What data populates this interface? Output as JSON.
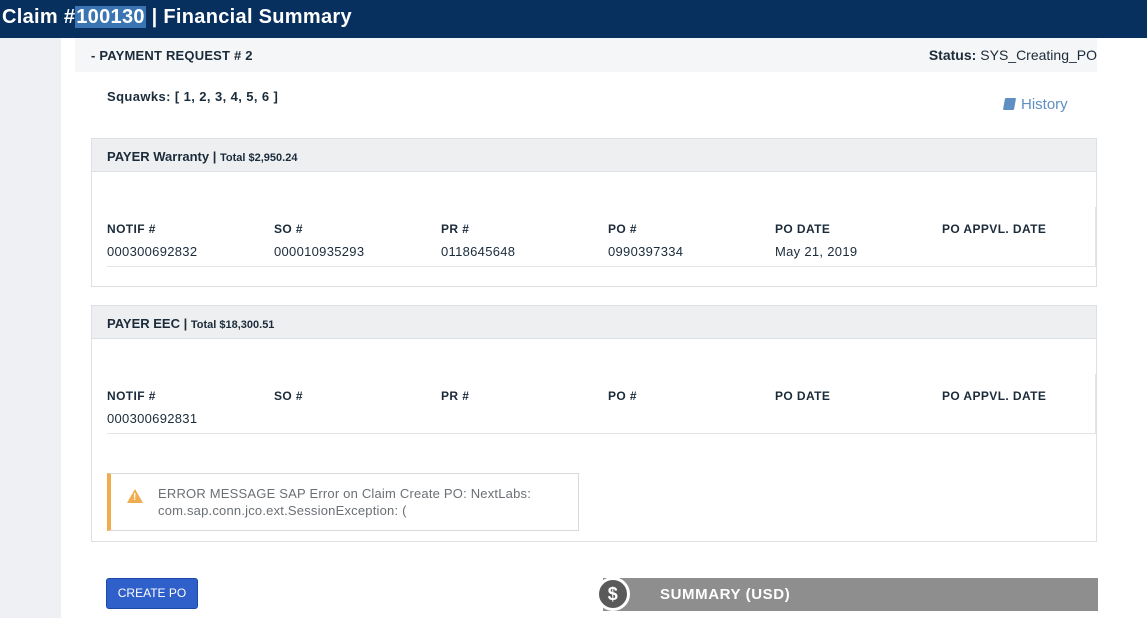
{
  "header": {
    "title_prefix": "Claim #",
    "claim_number": "100130",
    "title_suffix": " | Financial Summary"
  },
  "request": {
    "title": "- PAYMENT REQUEST # 2",
    "status_label": "Status:",
    "status_value": "SYS_Creating_PO",
    "squawks": "Squawks: [ 1, 2, 3, 4, 5, 6 ]",
    "history_label": "History",
    "history_icon": "book-icon"
  },
  "payers": [
    {
      "name": "PAYER Warranty |",
      "total": "Total $2,950.24",
      "columns": [
        {
          "header": "NOTIF #",
          "value": "000300692832"
        },
        {
          "header": "SO #",
          "value": "000010935293"
        },
        {
          "header": "PR #",
          "value": "0118645648"
        },
        {
          "header": "PO #",
          "value": "0990397334"
        },
        {
          "header": "PO DATE",
          "value": "May 21, 2019"
        },
        {
          "header": "PO APPVL. DATE",
          "value": ""
        }
      ]
    },
    {
      "name": "PAYER EEC |",
      "total": "Total $18,300.51",
      "columns": [
        {
          "header": "NOTIF #",
          "value": "000300692831"
        },
        {
          "header": "SO #",
          "value": ""
        },
        {
          "header": "PR #",
          "value": ""
        },
        {
          "header": "PO #",
          "value": ""
        },
        {
          "header": "PO DATE",
          "value": ""
        },
        {
          "header": "PO APPVL. DATE",
          "value": ""
        }
      ],
      "error": {
        "icon": "warning-icon",
        "message": "ERROR MESSAGE SAP Error on Claim Create PO: NextLabs: com.sap.conn.jco.ext.SessionException: ("
      }
    }
  ],
  "actions": {
    "create_po": "CREATE PO"
  },
  "summary": {
    "icon_glyph": "$",
    "label": "SUMMARY (USD)"
  },
  "colors": {
    "topbar": "#07305f",
    "highlight": "#3b74b3",
    "primary_button": "#2f5fc9",
    "warning": "#f0ad4e",
    "summary_bar": "#8e8e8e",
    "link": "#5f8fc2"
  }
}
